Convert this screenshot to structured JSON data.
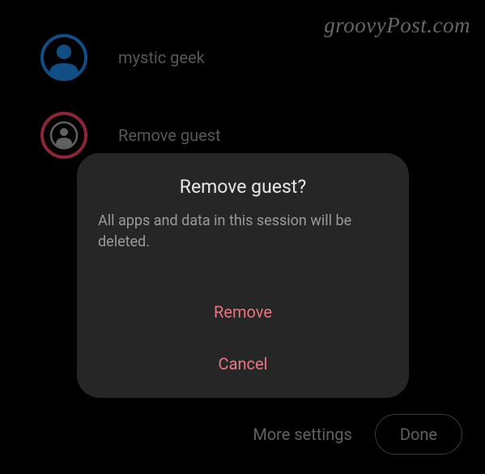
{
  "watermark": "groovyPost.com",
  "users": [
    {
      "label": "mystic geek"
    },
    {
      "label": "Remove guest"
    }
  ],
  "dialog": {
    "title": "Remove guest?",
    "message": "All apps and data in this session will be deleted.",
    "remove_label": "Remove",
    "cancel_label": "Cancel"
  },
  "footer": {
    "more_settings_label": "More settings",
    "done_label": "Done"
  },
  "colors": {
    "accent_blue": "#114e86",
    "accent_red": "#8d2439",
    "action_pink": "#e97485"
  }
}
